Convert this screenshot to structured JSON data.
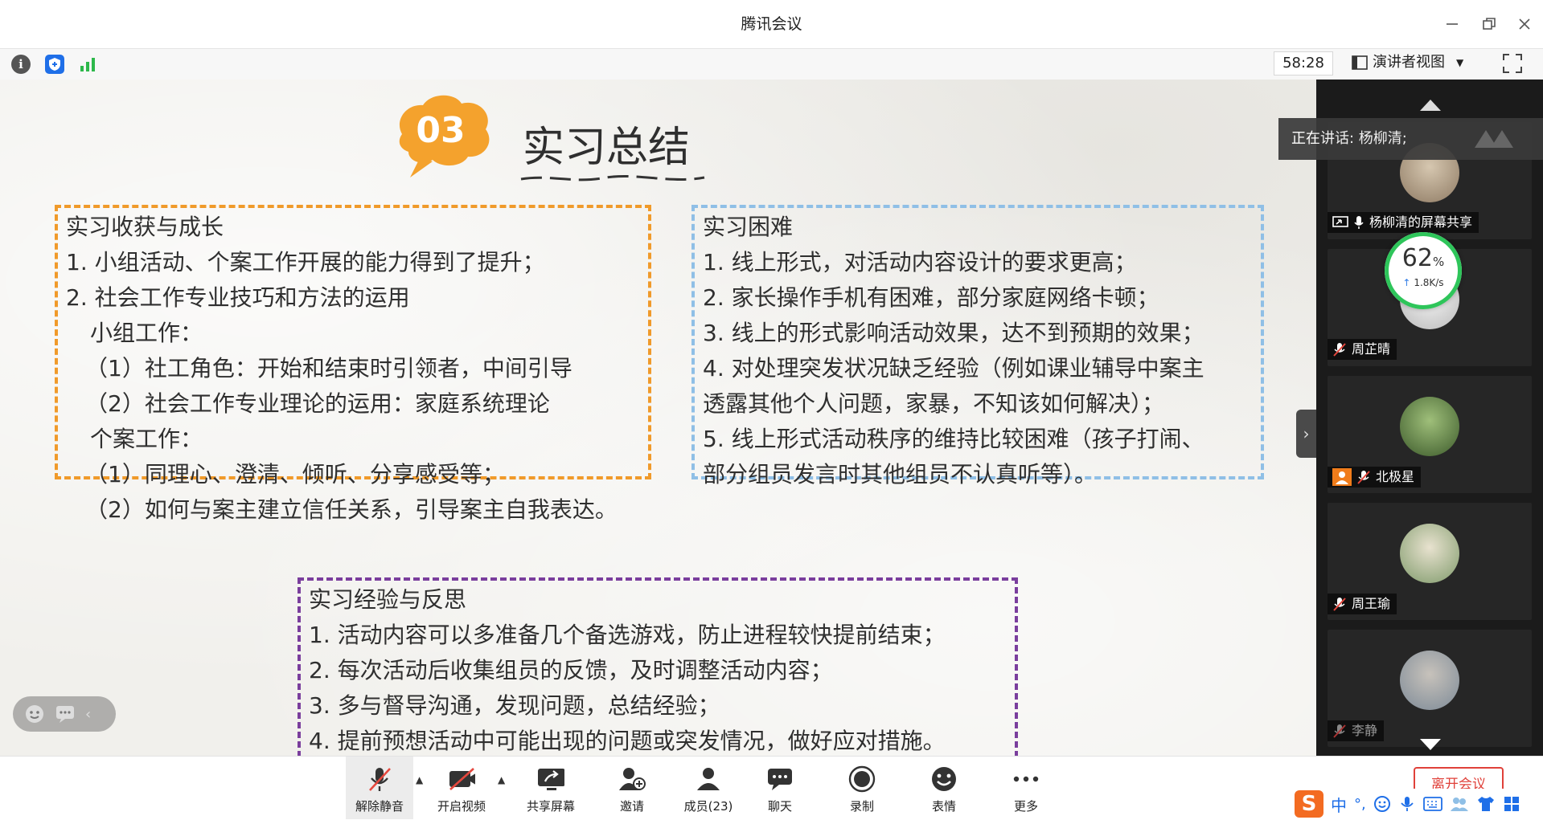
{
  "window": {
    "title": "腾讯会议"
  },
  "infobar": {
    "timer": "58:28",
    "view_label": "演讲者视图"
  },
  "slide": {
    "section_number": "03",
    "section_title": "实习总结",
    "box_gain": {
      "title": "实习收获与成长",
      "lines": [
        "1. 小组活动、个案工作开展的能力得到了提升；",
        "2. 社会工作专业技巧和方法的运用",
        "小组工作：",
        "（1）社工角色：开始和结束时引领者，中间引导",
        "（2）社会工作专业理论的运用：家庭系统理论",
        "个案工作：",
        "（1）同理心、澄清、倾听、分享感受等；",
        "（2）如何与案主建立信任关系，引导案主自我表达。"
      ]
    },
    "box_difficulty": {
      "title": "实习困难",
      "lines": [
        "1. 线上形式，对活动内容设计的要求更高；",
        "2. 家长操作手机有困难，部分家庭网络卡顿；",
        "3. 线上的形式影响活动效果，达不到预期的效果；",
        "4. 对处理突发状况缺乏经验（例如课业辅导中案主",
        "透露其他个人问题，家暴，不知该如何解决）；",
        "5. 线上形式活动秩序的维持比较困难（孩子打闹、",
        "部分组员发言时其他组员不认真听等）。"
      ]
    },
    "box_reflection": {
      "title": "实习经验与反思",
      "lines": [
        "1. 活动内容可以多准备几个备选游戏，防止进程较快提前结束；",
        "2. 每次活动后收集组员的反馈，及时调整活动内容；",
        "3. 多与督导沟通，发现问题，总结经验；",
        "4. 提前预想活动中可能出现的问题或突发情况，做好应对措施。"
      ]
    }
  },
  "sidebar": {
    "speaking_label": "正在讲话: 杨柳清;",
    "network": {
      "percent": "62",
      "percent_unit": "%",
      "speed": "1.8K/s"
    },
    "participants": [
      {
        "name": "杨柳清的屏幕共享"
      },
      {
        "name": "周芷晴"
      },
      {
        "name": "北极星"
      },
      {
        "name": "周王瑜"
      },
      {
        "name": "李静"
      }
    ]
  },
  "toolbar": {
    "unmute": "解除静音",
    "start_video": "开启视频",
    "share_screen": "共享屏幕",
    "invite": "邀请",
    "members": "成员(23)",
    "chat": "聊天",
    "record": "录制",
    "reactions": "表情",
    "more": "更多",
    "leave": "离开会议"
  },
  "ime": {
    "lang": "中",
    "punct": "°,"
  },
  "colors": {
    "gain_border": "#f09a2a",
    "difficulty_border": "#8fbfe6",
    "reflection_border": "#7a3e9d",
    "badge_orange": "#f4a22d",
    "leave_red": "#e0413a"
  }
}
